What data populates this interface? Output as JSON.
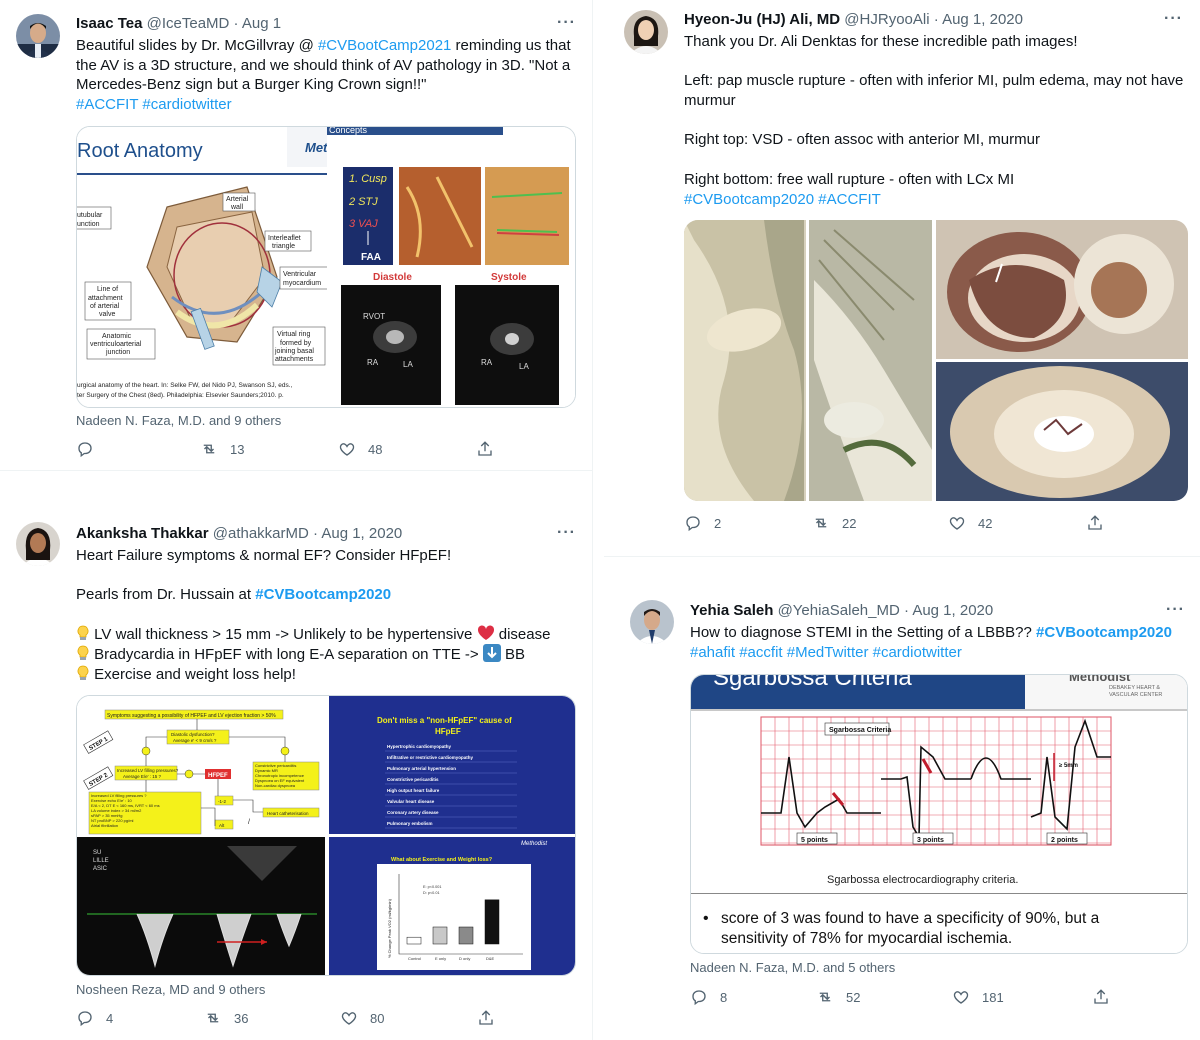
{
  "tweets": [
    {
      "name": "Isaac Tea",
      "handle": "@IceTeaMD",
      "date": "Aug 1",
      "lines": [
        [
          {
            "t": "Beautiful slides by Dr. McGillvray @ "
          },
          {
            "t": "#CVBootCamp2021",
            "c": "link"
          },
          {
            "t": " reminding us that"
          }
        ],
        [
          {
            "t": "the AV is a 3D structure, and we should think of AV pathology in 3D. \"Not a"
          }
        ],
        [
          {
            "t": "Mercedes-Benz sign but a Burger King Crown sign!!\""
          }
        ],
        [
          {
            "t": "#ACCFIT",
            "c": "link"
          },
          {
            "t": " "
          },
          {
            "t": "#cardiotwitter",
            "c": "link"
          }
        ]
      ],
      "media": {
        "slide_title": "Root Anatomy",
        "brand": "Met",
        "concepts": "Concepts",
        "labels": {
          "arterial_wall": [
            "Arterial",
            "wall"
          ],
          "subtubular": [
            "Subtubular",
            "junction"
          ],
          "interleaflet": [
            "Interleaflet",
            "triangle"
          ],
          "ventricular": [
            "Ventricular",
            "myocardium"
          ],
          "line_of": [
            "Line of",
            "attachment",
            "of arterial",
            "valve"
          ],
          "anatomic": [
            "Anatomic",
            "ventriculoarterial",
            "junction"
          ],
          "virtual": [
            "Virtual ring",
            "formed by",
            "joining basal",
            "attachments"
          ]
        },
        "cusp_labels": [
          "1. Cusp",
          "2 STJ",
          "3 VAJ",
          "FAA"
        ],
        "diastole": "Diastole",
        "systole": "Systole",
        "echo_labels": [
          "RVOT",
          "RA",
          "LA",
          "RA",
          "LA"
        ],
        "citation": [
          "urgical anatomy of the heart. In: Selke FW, del Nido PJ, Swanson SJ, eds.,",
          "ter Surgery of the Chest (8ed). Philadelphia: Elsevier Saunders;2010. p."
        ]
      },
      "liked_by": "Nadeen N. Faza, M.D. and 9 others",
      "reply_count": "",
      "retweet_count": "13",
      "like_count": "48"
    },
    {
      "name": "Hyeon-Ju (HJ) Ali, MD",
      "handle": "@HJRyooAli",
      "date": "Aug 1, 2020",
      "lines": [
        [
          {
            "t": "Thank you Dr. Ali Denktas for these incredible path images!"
          }
        ],
        [],
        [
          {
            "t": "Left: pap muscle rupture - often with inferior MI, pulm edema, may not have"
          }
        ],
        [
          {
            "t": "murmur"
          }
        ],
        [],
        [
          {
            "t": "Right top: VSD - often assoc with anterior MI, murmur"
          }
        ],
        [],
        [
          {
            "t": "Right bottom: free wall rupture - often with LCx MI"
          }
        ],
        [
          {
            "t": "#CVBootcamp2020",
            "c": "link"
          },
          {
            "t": " "
          },
          {
            "t": "#ACCFIT",
            "c": "link"
          }
        ]
      ],
      "liked_by": "",
      "reply_count": "2",
      "retweet_count": "22",
      "like_count": "42"
    },
    {
      "name": "Akanksha Thakkar",
      "handle": "@athakkarMD",
      "date": "Aug 1, 2020",
      "lines": [
        [
          {
            "t": "Heart Failure symptoms & normal EF? Consider HFpEF!"
          }
        ],
        [],
        [
          {
            "t": "Pearls from Dr. Hussain at "
          },
          {
            "t": "#CVBootcamp2020",
            "c": "link-b"
          }
        ],
        [],
        [
          {
            "e": "bulb"
          },
          {
            "t": " LV wall thickness > 15 mm -> Unlikely to be hypertensive "
          },
          {
            "e": "heart"
          },
          {
            "t": " disease"
          }
        ],
        [
          {
            "e": "bulb"
          },
          {
            "t": " Bradycardia in HFpEF with long E-A separation on TTE -> "
          },
          {
            "e": "down"
          },
          {
            "t": " BB"
          }
        ],
        [
          {
            "e": "bulb"
          },
          {
            "t": " Exercise and weight loss help!"
          }
        ]
      ],
      "media": {
        "algo_title": "Symptoms suggesting a possibility of HFPEF and LV ejection fraction > 50%",
        "step1": "STEP 1",
        "step2": "STEP 2",
        "diastolic": [
          "Diastolic dysfunction?",
          "Average e' < 9 cm/s ?"
        ],
        "increased": [
          "Increased LV filling pressures?",
          "Average E/e' : 15 ?"
        ],
        "hfpef": "HFPEF",
        "constrictive": [
          "Constrictive pericarditis",
          "Dynamic MR",
          "Chronotropic incompetence",
          "Dyspnoea on EF equivalent",
          "Non-cardiac dyspnoea"
        ],
        "filling": [
          "Increased LV filling pressures ?",
          "Exercise echo E/e' : 10",
          "E/A < 2, DT E < 160 ms, IVRT < 60 ms",
          "LA volume index > 34 ml/m2",
          "sPAP > 35 mmHg",
          "NT proBNP > 220 pg/ml",
          "Atrial fibrillation"
        ],
        "heart_cath": "Heart catheterisation",
        "small_marks": [
          "-1-2",
          "Alt",
          "/"
        ],
        "dont_miss": [
          "Don't miss a \"non-HFpEF\" cause of",
          "HFpEF"
        ],
        "causes": [
          "Hypertrophic cardiomyopathy",
          "Infiltrative or restrictive cardiomyopathy",
          "Pulmonary arterial hypertension",
          "Constrictive pericarditis",
          "High output heart failure",
          "Valvular heart disease",
          "Coronary artery disease",
          "Pulmonary embolism"
        ],
        "doppler_text": [
          "SU",
          "LILLE",
          "ASIC"
        ],
        "exercise_title": "What about Exercise and Weight loss?",
        "methodist": "Methodist",
        "bar_labels": [
          "Control",
          "E only",
          "D only",
          "D&E"
        ],
        "bar_values": [
          2,
          5,
          5,
          13
        ],
        "legend": [
          "E: p<0.001",
          "D: p<0.01"
        ],
        "y_label": "% Change Peak VO2 (ml/kg/min)"
      },
      "liked_by": "Nosheen Reza, MD and 9 others",
      "reply_count": "4",
      "retweet_count": "36",
      "like_count": "80"
    },
    {
      "name": "Yehia Saleh",
      "handle": "@YehiaSaleh_MD",
      "date": "Aug 1, 2020",
      "lines": [
        [
          {
            "t": "How to diagnose STEMI in the Setting of a LBBB?? "
          },
          {
            "t": "#CVBootcamp2020",
            "c": "link-b"
          }
        ],
        [
          {
            "t": "#ahafit",
            "c": "link"
          },
          {
            "t": " "
          },
          {
            "t": "#accfit",
            "c": "link"
          },
          {
            "t": " "
          },
          {
            "t": "#MedTwitter",
            "c": "link"
          },
          {
            "t": " "
          },
          {
            "t": "#cardiotwitter",
            "c": "link"
          }
        ]
      ],
      "media": {
        "slide_title": "Sgarbossa Criteria",
        "brand": "Methodist",
        "brand_sub": [
          "DEBAKEY HEART &",
          "VASCULAR CENTER"
        ],
        "ecg_title": "Sgarbossa Criteria",
        "points": [
          "5 points",
          "3 points",
          "2 points"
        ],
        "mm_label": "≥ 5mm",
        "caption": "Sgarbossa electrocardiography criteria.",
        "bullet": [
          "score of 3 was found to have a specificity of 90%, but a",
          "sensitivity of 78% for myocardial ischemia."
        ]
      },
      "liked_by": "Nadeen N. Faza, M.D. and 5 others",
      "reply_count": "8",
      "retweet_count": "52",
      "like_count": "181"
    }
  ],
  "colors": {
    "link": "#1d9bf0",
    "muted": "#536471",
    "text": "#0f1419",
    "border": "#cfd9de"
  },
  "icons": [
    "more-icon",
    "reply-icon",
    "retweet-icon",
    "like-icon",
    "share-icon",
    "bulb-emoji",
    "heart-emoji",
    "down-arrow-emoji"
  ]
}
